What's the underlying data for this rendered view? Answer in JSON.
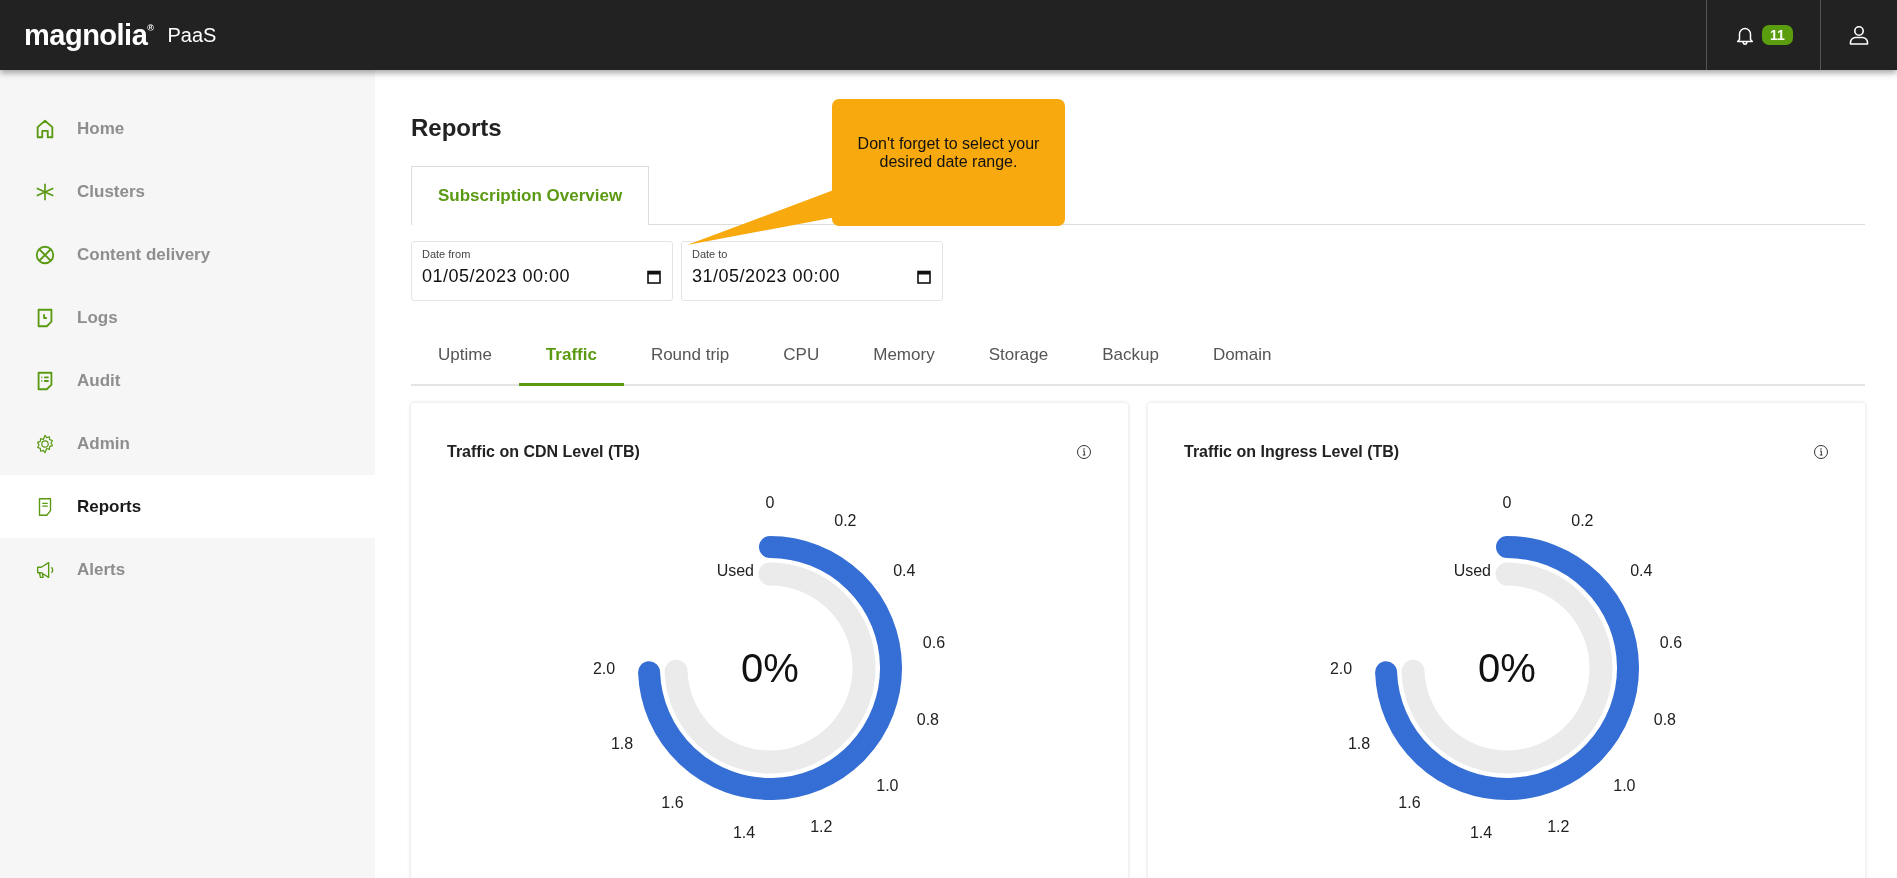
{
  "header": {
    "logo": "magnolia",
    "logo_mark": "®",
    "product": "PaaS",
    "notifications": "11"
  },
  "sidebar": {
    "items": [
      {
        "label": "Home",
        "selected": false
      },
      {
        "label": "Clusters",
        "selected": false
      },
      {
        "label": "Content delivery",
        "selected": false
      },
      {
        "label": "Logs",
        "selected": false
      },
      {
        "label": "Audit",
        "selected": false
      },
      {
        "label": "Admin",
        "selected": false
      },
      {
        "label": "Reports",
        "selected": true
      },
      {
        "label": "Alerts",
        "selected": false
      }
    ]
  },
  "page": {
    "title": "Reports"
  },
  "tabs": [
    {
      "label": "Subscription Overview",
      "selected": true
    }
  ],
  "tooltip": "Don't forget to select your desired date range.",
  "date_fields": [
    {
      "label": "Date from",
      "value": "01/05/2023 00:00"
    },
    {
      "label": "Date to",
      "value": "31/05/2023 00:00"
    }
  ],
  "metric_tabs": [
    {
      "label": "Uptime",
      "selected": false
    },
    {
      "label": "Traffic",
      "selected": true
    },
    {
      "label": "Round trip",
      "selected": false
    },
    {
      "label": "CPU",
      "selected": false
    },
    {
      "label": "Memory",
      "selected": false
    },
    {
      "label": "Storage",
      "selected": false
    },
    {
      "label": "Backup",
      "selected": false
    },
    {
      "label": "Domain",
      "selected": false
    }
  ],
  "cards": [
    {
      "title": "Traffic on CDN Level (TB)",
      "series_label": "Used",
      "percent": "0%",
      "ticks": [
        "0",
        "0.2",
        "0.4",
        "0.6",
        "0.8",
        "1.0",
        "1.2",
        "1.4",
        "1.6",
        "1.8",
        "2.0"
      ]
    },
    {
      "title": "Traffic on Ingress Level (TB)",
      "series_label": "Used",
      "percent": "0%",
      "ticks": [
        "0",
        "0.2",
        "0.4",
        "0.6",
        "0.8",
        "1.0",
        "1.2",
        "1.4",
        "1.6",
        "1.8",
        "2.0"
      ]
    }
  ]
}
